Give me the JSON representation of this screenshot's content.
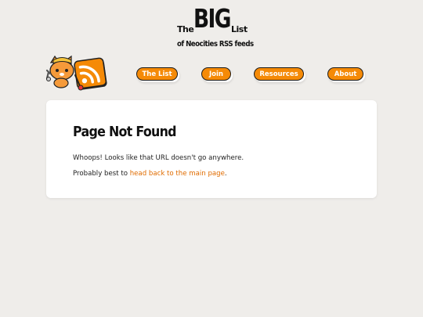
{
  "header": {
    "title_the": "The",
    "title_big": "BIG",
    "title_list": "List",
    "subtitle": "of Neocities RSS feeds"
  },
  "logo": {
    "icons": [
      "neocities-cat-icon",
      "rss-icon"
    ]
  },
  "nav": {
    "items": [
      {
        "label": "The List"
      },
      {
        "label": "Join"
      },
      {
        "label": "Resources"
      },
      {
        "label": "About"
      }
    ]
  },
  "main": {
    "heading": "Page Not Found",
    "message": "Whoops! Looks like that URL doesn't go anywhere.",
    "suggestion_prefix": "Probably best to ",
    "suggestion_link": "head back to the main page",
    "suggestion_suffix": "."
  },
  "colors": {
    "accent": "#f58a07",
    "link": "#e06c00",
    "background": "#efedea",
    "card": "#ffffff"
  }
}
